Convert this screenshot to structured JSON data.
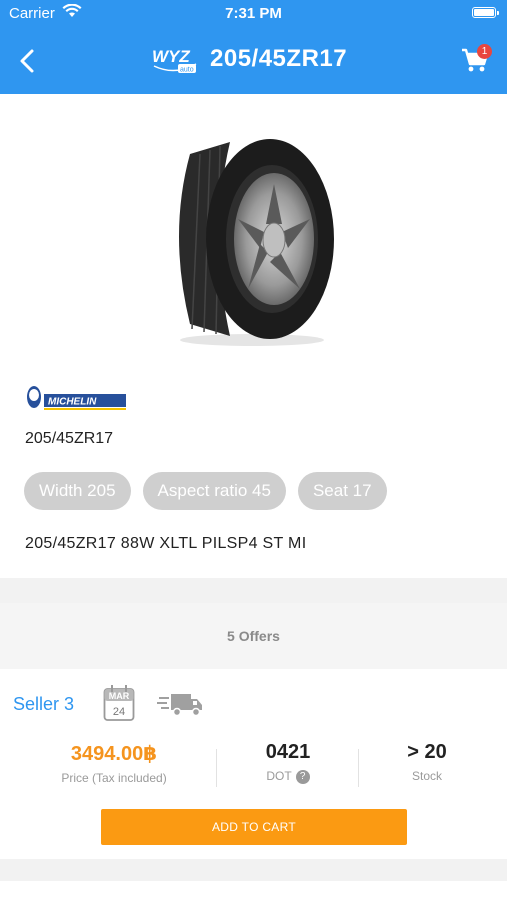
{
  "status_bar": {
    "carrier": "Carrier",
    "time": "7:31 PM"
  },
  "header": {
    "title": "205/45ZR17",
    "logo_text": "WYZ",
    "logo_subtext": "auto",
    "cart_badge": "1",
    "colors": {
      "primary": "#2f96f0",
      "badge": "#e8463f"
    }
  },
  "product": {
    "brand": "MICHELIN",
    "size": "205/45ZR17",
    "specs": [
      "Width 205",
      "Aspect ratio 45",
      "Seat 17"
    ],
    "description": "205/45ZR17 88W XLTL PILSP4 ST MI"
  },
  "offers": {
    "count_label": "5 Offers",
    "items": [
      {
        "seller": "Seller 3",
        "calendar_month": "MAR",
        "calendar_day": "24",
        "price": "3494.00฿",
        "price_label": "Price (Tax included)",
        "dot": "0421",
        "dot_label": "DOT",
        "stock": "> 20",
        "stock_label": "Stock",
        "add_to_cart_label": "ADD TO CART",
        "colors": {
          "price": "#f5941e",
          "button": "#fb9a12"
        }
      }
    ]
  }
}
